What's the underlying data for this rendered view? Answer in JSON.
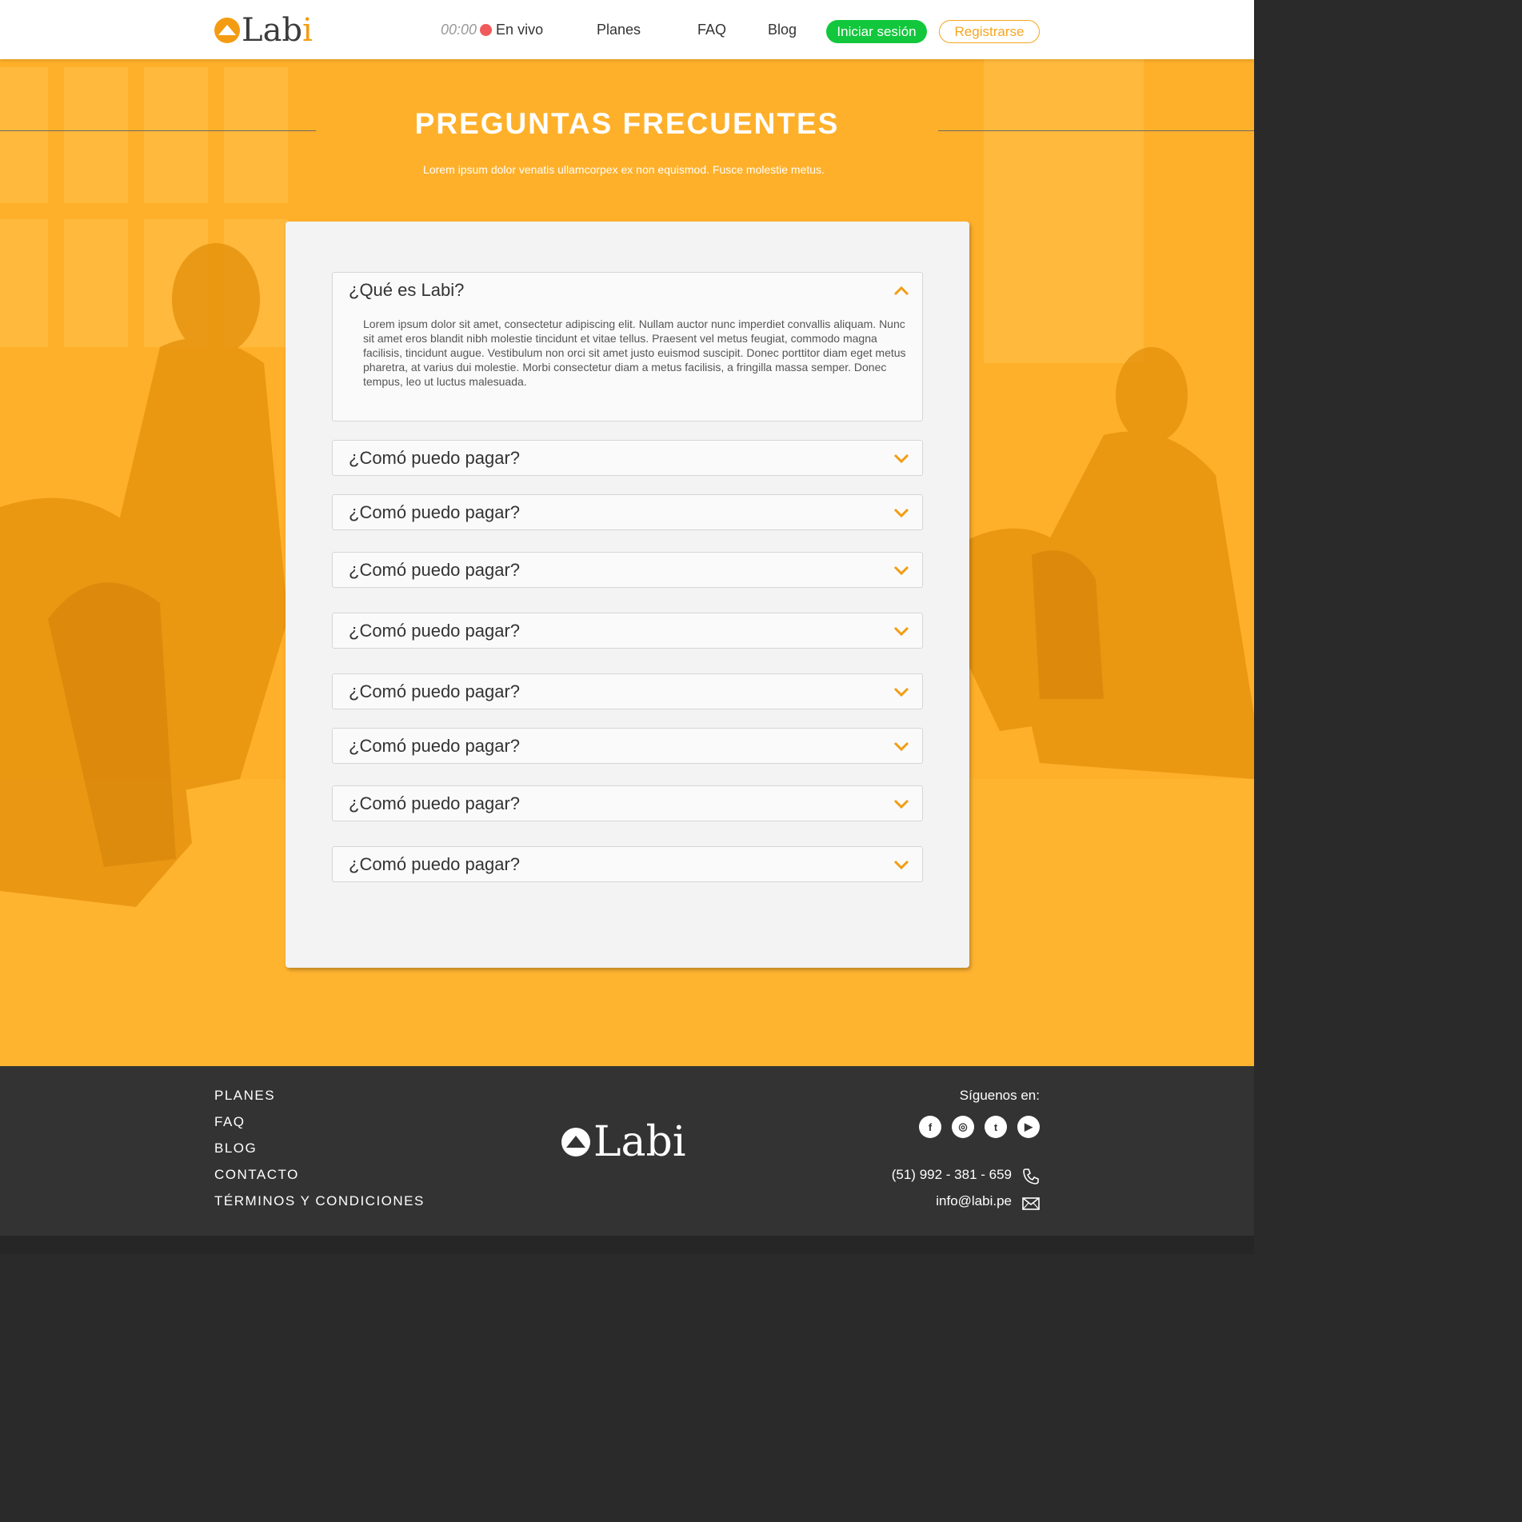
{
  "header": {
    "logo_text_main": "Lab",
    "logo_text_accent": "i",
    "live_time": "00:00",
    "live_label": "En vivo",
    "nav": [
      "Planes",
      "FAQ",
      "Blog"
    ],
    "login_label": "Iniciar sesión",
    "register_label": "Registrarse"
  },
  "hero": {
    "title": "PREGUNTAS FRECUENTES",
    "subtitle": "Lorem ipsum dolor venatis ullamcorpex ex non equismod. Fusce molestie metus."
  },
  "faq": {
    "items": [
      {
        "question": "¿Qué es Labi?",
        "expanded": true,
        "answer": "Lorem ipsum dolor sit amet, consectetur adipiscing elit. Nullam auctor nunc imperdiet convallis aliquam. Nunc sit amet eros blandit nibh molestie tincidunt et vitae tellus. Praesent vel metus feugiat, commodo magna facilisis, tincidunt augue. Vestibulum non orci sit amet justo euismod suscipit. Donec porttitor diam eget metus pharetra, at varius dui molestie. Morbi consectetur diam a metus facilisis, a fringilla massa semper. Donec tempus, leo ut luctus malesuada."
      },
      {
        "question": "¿Comó puedo pagar?",
        "expanded": false
      },
      {
        "question": "¿Comó puedo pagar?",
        "expanded": false
      },
      {
        "question": "¿Comó puedo pagar?",
        "expanded": false
      },
      {
        "question": "¿Comó puedo pagar?",
        "expanded": false
      },
      {
        "question": "¿Comó puedo pagar?",
        "expanded": false
      },
      {
        "question": "¿Comó puedo pagar?",
        "expanded": false
      },
      {
        "question": "¿Comó puedo pagar?",
        "expanded": false
      },
      {
        "question": "¿Comó puedo pagar?",
        "expanded": false
      }
    ]
  },
  "footer": {
    "links": [
      "PLANES",
      "FAQ",
      "BLOG",
      "CONTACTO",
      "TÉRMINOS Y CONDICIONES"
    ],
    "logo_text": "Labi",
    "follow_label": "Síguenos en:",
    "socials": [
      {
        "icon": "facebook-icon",
        "glyph": "f"
      },
      {
        "icon": "instagram-icon",
        "glyph": "◎"
      },
      {
        "icon": "twitter-icon",
        "glyph": "t"
      },
      {
        "icon": "youtube-icon",
        "glyph": "▶"
      }
    ],
    "phone": "(51) 992 - 381 - 659",
    "email": "info@labi.pe"
  },
  "colors": {
    "accent": "#f39c12",
    "hero_bg": "#ffb02a",
    "login_green": "#12c73c",
    "live_dot": "#f05a5a",
    "footer_bg": "#333333"
  }
}
